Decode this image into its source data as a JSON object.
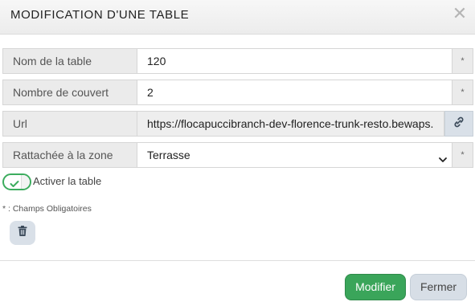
{
  "header": {
    "title": "MODIFICATION D'UNE TABLE",
    "close_icon": "close-icon"
  },
  "fields": {
    "name": {
      "label": "Nom de la table",
      "value": "120",
      "required": "*"
    },
    "covers": {
      "label": "Nombre de couvert",
      "value": "2",
      "required": "*"
    },
    "url": {
      "label": "Url",
      "value": "https://flocapuccibranch-dev-florence-trunk-resto.bewaps.",
      "action_icon": "link-icon"
    },
    "zone": {
      "label": "Rattachée à la zone",
      "value": "Terrasse",
      "required": "*"
    }
  },
  "toggle": {
    "label": "Activer la table",
    "checked": true
  },
  "required_note": "* : Champs Obligatoires",
  "actions": {
    "delete_icon": "trash-icon",
    "submit_label": "Modifier",
    "close_label": "Fermer"
  },
  "colors": {
    "primary": "#3aa55a",
    "secondary": "#d7dee6",
    "toggle_accent": "#3cac5e"
  }
}
